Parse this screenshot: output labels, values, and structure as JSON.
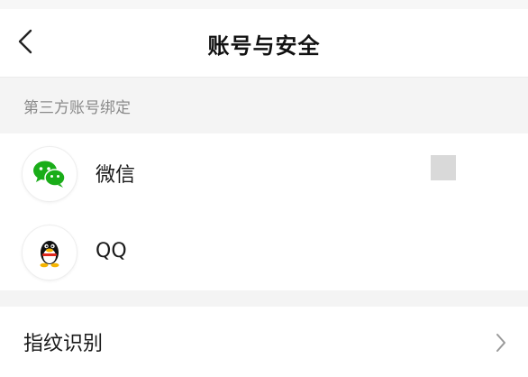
{
  "header": {
    "title": "账号与安全",
    "back_icon": "chevron-left-icon"
  },
  "section": {
    "label": "第三方账号绑定"
  },
  "bindings": [
    {
      "label": "微信",
      "icon": "wechat-icon",
      "accent": "#1aad19"
    },
    {
      "label": "QQ",
      "icon": "qq-penguin-icon",
      "accent": "#f5b400"
    }
  ],
  "settings": {
    "fingerprint_label": "指纹识别",
    "chevron_icon": "chevron-right-icon"
  },
  "colors": {
    "background": "#f5f5f5",
    "section_text": "#8a8a8a",
    "wechat_green": "#1aad19"
  }
}
